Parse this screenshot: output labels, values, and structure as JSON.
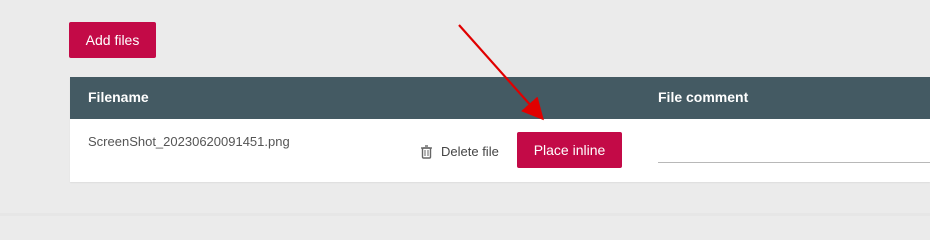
{
  "toolbar": {
    "add_files_label": "Add files"
  },
  "table": {
    "headers": {
      "filename": "Filename",
      "file_comment": "File comment"
    },
    "rows": [
      {
        "filename": "ScreenShot_20230620091451.png",
        "delete_label": "Delete file",
        "place_inline_label": "Place inline",
        "comment_value": ""
      }
    ]
  },
  "colors": {
    "primary_button": "#c30a47",
    "header_background": "#445a63",
    "page_background": "#ebebeb",
    "annotation_arrow": "#e00000"
  },
  "icons": {
    "delete": "trash-icon"
  }
}
